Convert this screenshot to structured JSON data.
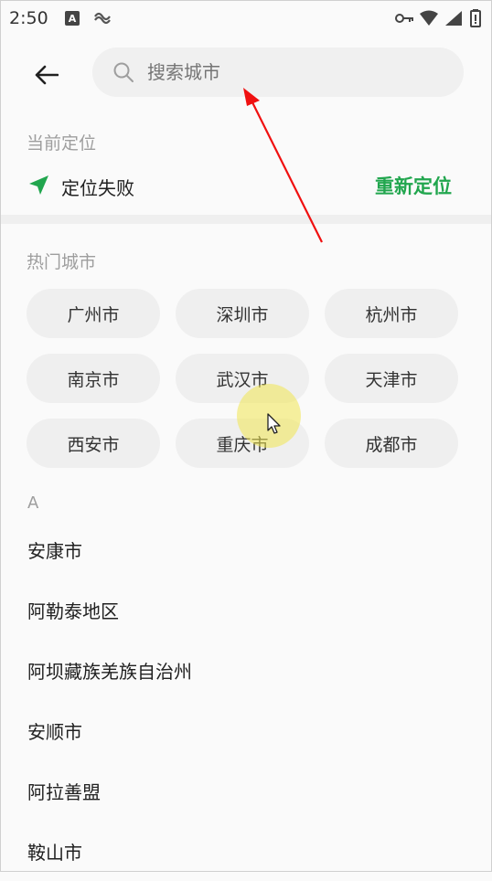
{
  "status_bar": {
    "time": "2:50",
    "icons": [
      "a-icon",
      "bird-icon",
      "key-icon",
      "wifi-icon",
      "signal-icon",
      "battery-icon"
    ]
  },
  "header": {
    "back_icon": "arrow-left-icon",
    "search": {
      "placeholder": "搜索城市",
      "value": ""
    }
  },
  "current_location": {
    "section_title": "当前定位",
    "status": "定位失败",
    "relocate_label": "重新定位"
  },
  "hot_cities": {
    "section_title": "热门城市",
    "cities": [
      "广州市",
      "深圳市",
      "杭州市",
      "南京市",
      "武汉市",
      "天津市",
      "西安市",
      "重庆市",
      "成都市"
    ]
  },
  "city_index": {
    "letter": "A",
    "cities": [
      "安康市",
      "阿勒泰地区",
      "阿坝藏族羌族自治州",
      "安顺市",
      "阿拉善盟",
      "鞍山市"
    ]
  },
  "colors": {
    "accent": "#21a64e",
    "chip_bg": "#efefef",
    "annotation_arrow": "#f01010"
  }
}
